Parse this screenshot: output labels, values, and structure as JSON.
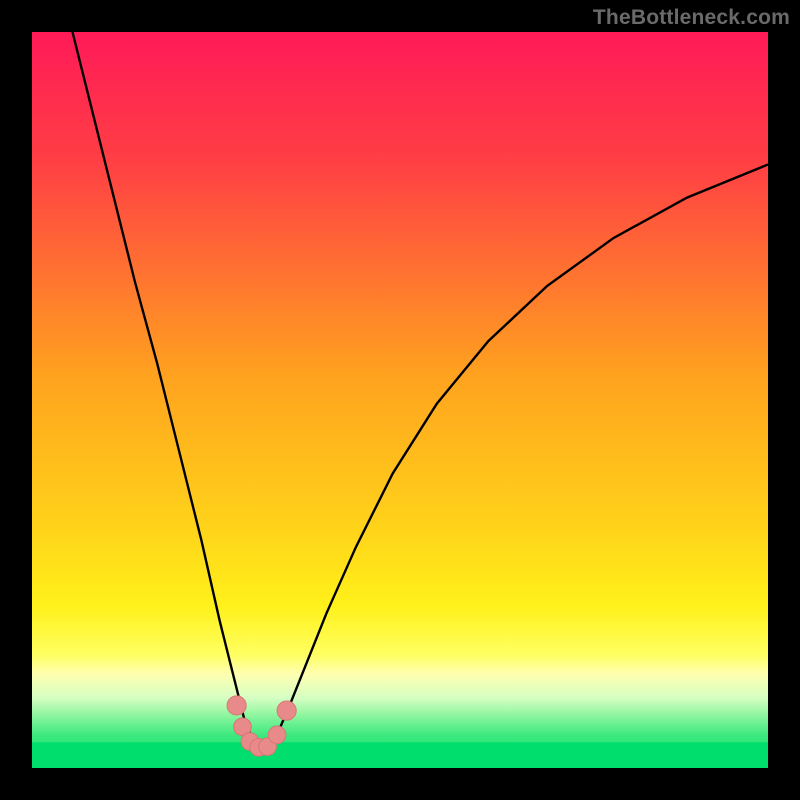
{
  "watermark": "TheBottleneck.com",
  "colors": {
    "frame": "#000000",
    "curve": "#000000",
    "marker_fill": "#e88a89",
    "marker_stroke": "#d87674",
    "green_band_top": "#00e36f",
    "green_band_bottom": "#00df6d"
  },
  "chart_data": {
    "type": "line",
    "title": "",
    "xlabel": "",
    "ylabel": "",
    "xlim": [
      0,
      100
    ],
    "ylim": [
      0,
      100
    ],
    "notes": "V-shaped bottleneck curve. x is an abstract parameter sweep; y is bottleneck magnitude (lower is better). Minimum sits near x≈31. Background gradient runs from green (y≈0, optimal) through yellow/orange to red (y high, severe bottleneck). No numeric axis ticks are shown in the image; values below are estimated from pixel positions.",
    "gradient_stops": [
      {
        "y_frac": 0.0,
        "color": "#ff1a58"
      },
      {
        "y_frac": 0.18,
        "color": "#ff4044"
      },
      {
        "y_frac": 0.47,
        "color": "#ffa31e"
      },
      {
        "y_frac": 0.67,
        "color": "#ffd21a"
      },
      {
        "y_frac": 0.78,
        "color": "#fff11a"
      },
      {
        "y_frac": 0.845,
        "color": "#ffff60"
      },
      {
        "y_frac": 0.872,
        "color": "#ffffb0"
      },
      {
        "y_frac": 0.905,
        "color": "#d5ffc3"
      },
      {
        "y_frac": 0.925,
        "color": "#98f7a3"
      },
      {
        "y_frac": 0.955,
        "color": "#3ee97f"
      },
      {
        "y_frac": 1.0,
        "color": "#00de6d"
      }
    ],
    "series": [
      {
        "name": "bottleneck-curve",
        "x": [
          5.5,
          8,
          11,
          14,
          17,
          20,
          23,
          25.5,
          27.5,
          29,
          30.5,
          32,
          33.5,
          35,
          37,
          40,
          44,
          49,
          55,
          62,
          70,
          79,
          89,
          100
        ],
        "y": [
          100,
          90,
          78,
          66,
          55,
          43,
          31,
          20,
          12,
          6,
          3,
          3,
          5,
          8.5,
          13.5,
          21,
          30,
          40,
          49.5,
          58,
          65.5,
          72,
          77.5,
          82
        ]
      }
    ],
    "markers": [
      {
        "x": 27.8,
        "y": 8.5,
        "r": 1.3
      },
      {
        "x": 28.6,
        "y": 5.6,
        "r": 1.2
      },
      {
        "x": 29.6,
        "y": 3.6,
        "r": 1.2
      },
      {
        "x": 30.8,
        "y": 2.8,
        "r": 1.2
      },
      {
        "x": 32.0,
        "y": 2.9,
        "r": 1.2
      },
      {
        "x": 33.3,
        "y": 4.5,
        "r": 1.2
      },
      {
        "x": 34.6,
        "y": 7.8,
        "r": 1.3
      }
    ]
  }
}
